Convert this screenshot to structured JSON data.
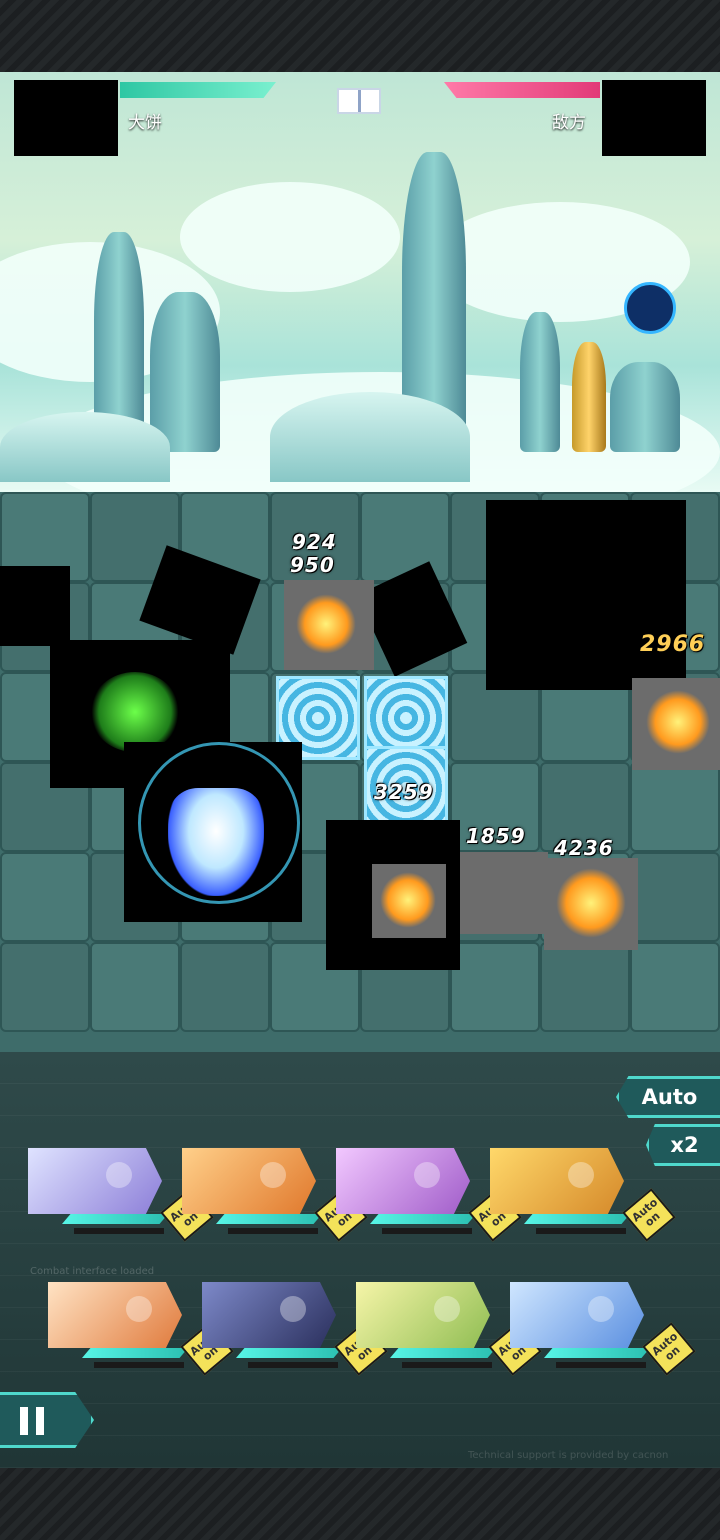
{
  "hud": {
    "player_name": "大饼",
    "enemy_name": "敌方"
  },
  "battle": {
    "damage_numbers": [
      "924",
      "950",
      "3259",
      "1859",
      "4236",
      "2966"
    ]
  },
  "controls": {
    "auto_label": "Auto",
    "speed_label": "x2"
  },
  "heroes": [
    {
      "auto": "Auto",
      "state": "on"
    },
    {
      "auto": "Auto",
      "state": "on"
    },
    {
      "auto": "Auto",
      "state": "on"
    },
    {
      "auto": "Auto",
      "state": "on"
    },
    {
      "auto": "Auto",
      "state": "on"
    },
    {
      "auto": "Auto",
      "state": "on"
    },
    {
      "auto": "Auto",
      "state": "on"
    },
    {
      "auto": "Auto",
      "state": "on"
    }
  ],
  "panel_text": {
    "log": "Combat interface loaded",
    "footer": "Technical support is provided by cacnon"
  },
  "colors": {
    "player_hp": "#2ec7a3",
    "enemy_hp": "#e23a78",
    "accent": "#4fd8cc",
    "auto_tag": "#f4e25a"
  }
}
